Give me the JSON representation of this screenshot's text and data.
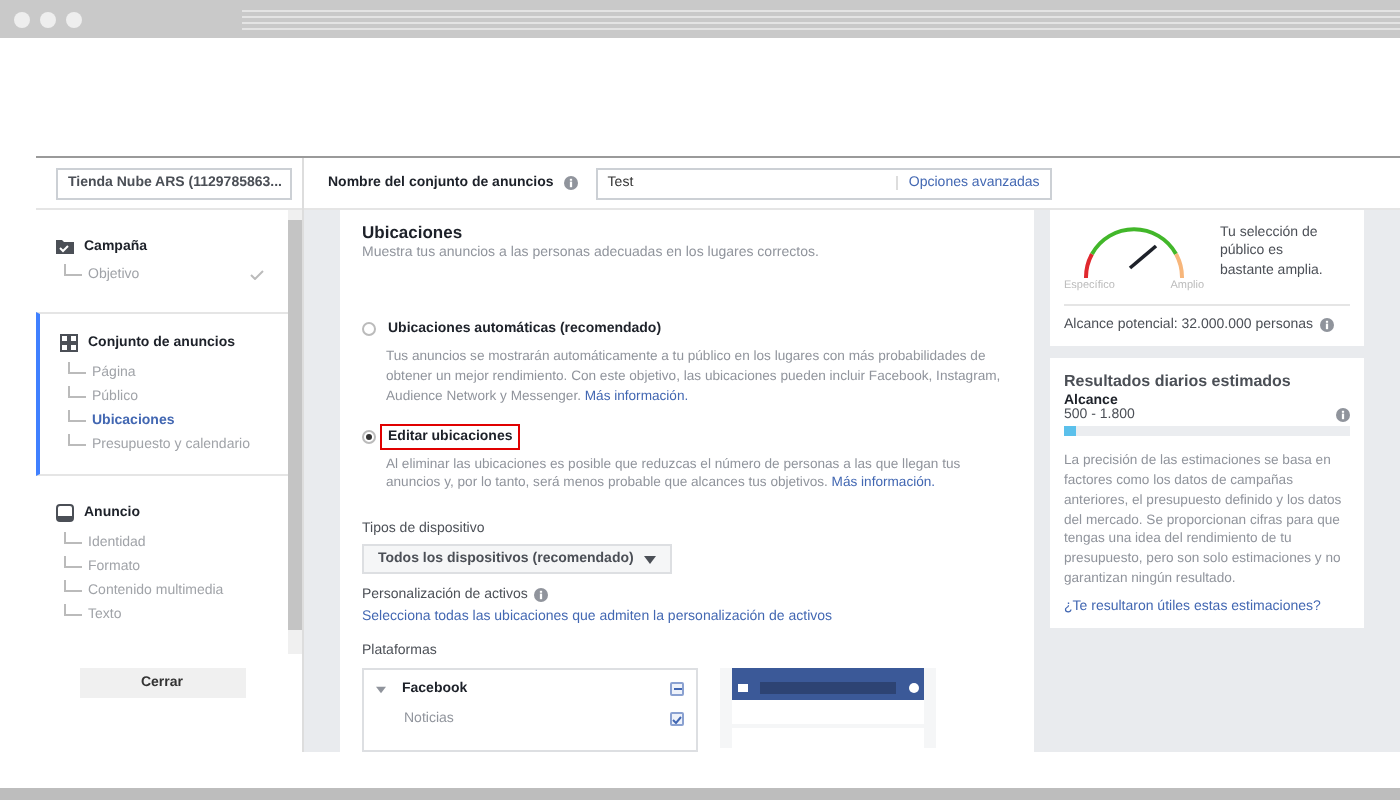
{
  "account_selector": {
    "label": "Tienda Nube ARS (1129785863..."
  },
  "sidebar": {
    "sections": [
      {
        "kind": "campaign",
        "title": "Campaña",
        "selected": false,
        "children": [
          {
            "label": "Objetivo",
            "done": true,
            "selected": false
          }
        ]
      },
      {
        "kind": "adset",
        "title": "Conjunto de anuncios",
        "selected": true,
        "children": [
          {
            "label": "Página",
            "done": false,
            "selected": false
          },
          {
            "label": "Público",
            "done": false,
            "selected": false
          },
          {
            "label": "Ubicaciones",
            "done": false,
            "selected": true
          },
          {
            "label": "Presupuesto y calendario",
            "done": false,
            "selected": false
          }
        ]
      },
      {
        "kind": "ad",
        "title": "Anuncio",
        "selected": false,
        "children": [
          {
            "label": "Identidad",
            "done": false,
            "selected": false
          },
          {
            "label": "Formato",
            "done": false,
            "selected": false
          },
          {
            "label": "Contenido multimedia",
            "done": false,
            "selected": false
          },
          {
            "label": "Texto",
            "done": false,
            "selected": false
          }
        ]
      }
    ],
    "close_button": "Cerrar"
  },
  "ad_set_name": {
    "label": "Nombre del conjunto de anuncios",
    "value": "Test",
    "advanced": "Opciones avanzadas"
  },
  "placements": {
    "title": "Ubicaciones",
    "subtitle": "Muestra tus anuncios a las personas adecuadas en los lugares correctos.",
    "options": [
      {
        "label": "Ubicaciones automáticas (recomendado)",
        "description": "Tus anuncios se mostrarán automáticamente a tu público en los lugares con más probabilidades de obtener un mejor rendimiento. Con este objetivo, las ubicaciones pueden incluir Facebook, Instagram, Audience Network y Messenger.",
        "link": "Más información.",
        "selected": false,
        "highlighted": false
      },
      {
        "label": "Editar ubicaciones",
        "description": "Al eliminar las ubicaciones es posible que reduzcas el número de personas a las que llegan tus anuncios y, por lo tanto, será menos probable que alcances tus objetivos.",
        "link": "Más información.",
        "selected": true,
        "highlighted": true
      }
    ]
  },
  "device_types": {
    "label": "Tipos de dispositivo",
    "value": "Todos los dispositivos (recomendado)"
  },
  "asset_customization": {
    "label": "Personalización de activos",
    "link": "Selecciona todas las ubicaciones que admiten la personalización de activos"
  },
  "platforms": {
    "label": "Plataformas",
    "items": [
      {
        "kind": "group",
        "label": "Facebook",
        "expanded": true,
        "partial": true
      },
      {
        "kind": "item",
        "label": "Noticias",
        "checked": true
      }
    ]
  },
  "audience": {
    "specific": "Específico",
    "broad": "Amplio",
    "summary": "Tu selección de público es bastante amplia.",
    "potential_reach": "Alcance potencial: 32.000.000 personas"
  },
  "estimates": {
    "title": "Resultados diarios estimados",
    "metric": "Alcance",
    "range": "500 - 1.800",
    "level": 0.04,
    "note": "La precisión de las estimaciones se basa en factores como los datos de campañas anteriores, el presupuesto definido y los datos del mercado. Se proporcionan cifras para que tengas una idea del rendimiento de tu presupuesto, pero son solo estimaciones y no garantizan ningún resultado.",
    "link": "¿Te resultaron útiles estas estimaciones?"
  }
}
